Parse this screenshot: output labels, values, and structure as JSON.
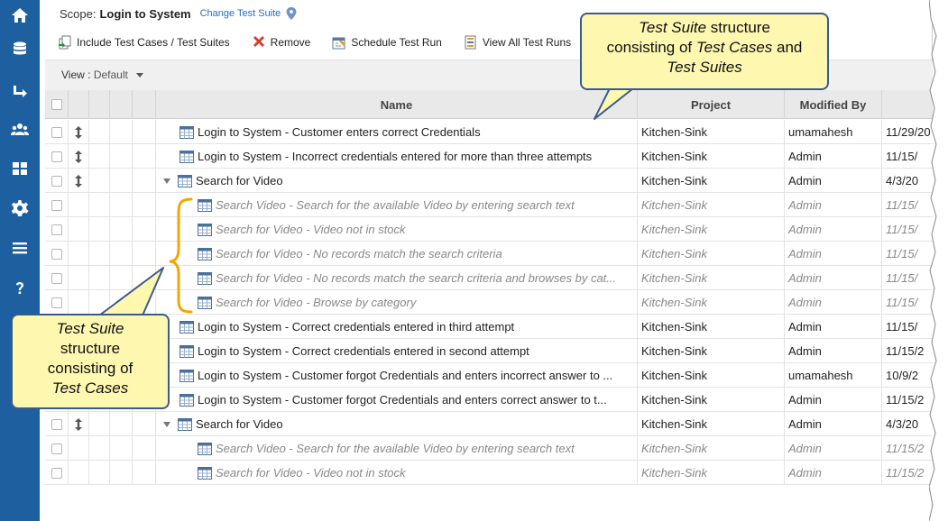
{
  "scope": {
    "label": "Scope:",
    "value": "Login to System",
    "change_link": "Change Test Suite"
  },
  "toolbar": {
    "include": "Include Test Cases / Test Suites",
    "remove": "Remove",
    "schedule": "Schedule Test Run",
    "view_all": "View All Test Runs"
  },
  "view": {
    "label": "View :",
    "selected": "Default"
  },
  "columns": {
    "name": "Name",
    "project": "Project",
    "modified_by": "Modified By"
  },
  "rows": [
    {
      "name": "Login to System - Customer enters correct Credentials",
      "project": "Kitchen-Sink",
      "modified_by": "umamahesh",
      "date": "11/29/20"
    },
    {
      "name": "Login to System - Incorrect credentials entered for more than three attempts",
      "project": "Kitchen-Sink",
      "modified_by": "Admin",
      "date": "11/15/"
    },
    {
      "name": "Search for Video",
      "project": "Kitchen-Sink",
      "modified_by": "Admin",
      "date": "4/3/20"
    },
    {
      "name": "Search Video - Search for the available Video by entering search text",
      "project": "Kitchen-Sink",
      "modified_by": "Admin",
      "date": "11/15/"
    },
    {
      "name": "Search for Video - Video not in stock",
      "project": "Kitchen-Sink",
      "modified_by": "Admin",
      "date": "11/15/"
    },
    {
      "name": "Search for Video - No records match the search criteria",
      "project": "Kitchen-Sink",
      "modified_by": "Admin",
      "date": "11/15/"
    },
    {
      "name": "Search for Video - No records match the search criteria and browses by cat...",
      "project": "Kitchen-Sink",
      "modified_by": "Admin",
      "date": "11/15/"
    },
    {
      "name": "Search for Video - Browse by category",
      "project": "Kitchen-Sink",
      "modified_by": "Admin",
      "date": "11/15/"
    },
    {
      "name": "Login to System - Correct credentials entered in third attempt",
      "project": "Kitchen-Sink",
      "modified_by": "Admin",
      "date": "11/15/"
    },
    {
      "name": "Login to System - Correct credentials entered in second attempt",
      "project": "Kitchen-Sink",
      "modified_by": "Admin",
      "date": "11/15/2"
    },
    {
      "name": "Login to System - Customer forgot Credentials and enters incorrect answer to ...",
      "project": "Kitchen-Sink",
      "modified_by": "umamahesh",
      "date": "10/9/2"
    },
    {
      "name": "Login to System - Customer forgot Credentials and enters correct answer to t...",
      "project": "Kitchen-Sink",
      "modified_by": "Admin",
      "date": "11/15/2"
    },
    {
      "name": "Search for Video",
      "project": "Kitchen-Sink",
      "modified_by": "Admin",
      "date": "4/3/20"
    },
    {
      "name": "Search Video - Search for the available Video by entering search text",
      "project": "Kitchen-Sink",
      "modified_by": "Admin",
      "date": "11/15/2"
    },
    {
      "name": "Search for Video - Video not in stock",
      "project": "Kitchen-Sink",
      "modified_by": "Admin",
      "date": "11/15/2"
    }
  ],
  "callouts": {
    "top": {
      "line1_em": "Test Suite",
      "line1_rest": " structure",
      "line2_pre": "consisting of ",
      "line2_em": "Test Cases",
      "line2_post": " and",
      "line3_em": "Test Suites"
    },
    "left": {
      "line1_em": "Test Suite",
      "line2": "structure",
      "line3": "consisting of",
      "line4_em": "Test Cases"
    }
  },
  "colors": {
    "sidebar": "#1e5fa0",
    "link": "#1f6fc5",
    "callout_fill": "#fdf7b0",
    "callout_border": "#3a5b8c",
    "bracket": "#f0a800"
  },
  "icons": [
    "home-icon",
    "database-icon",
    "arrow-return-icon",
    "users-icon",
    "grid-icon",
    "gear-icon",
    "menu-icon",
    "help-icon",
    "map-pin-icon",
    "include-icon",
    "remove-icon",
    "schedule-icon",
    "view-runs-icon",
    "drag-icon",
    "table-icon",
    "expand-icon"
  ]
}
